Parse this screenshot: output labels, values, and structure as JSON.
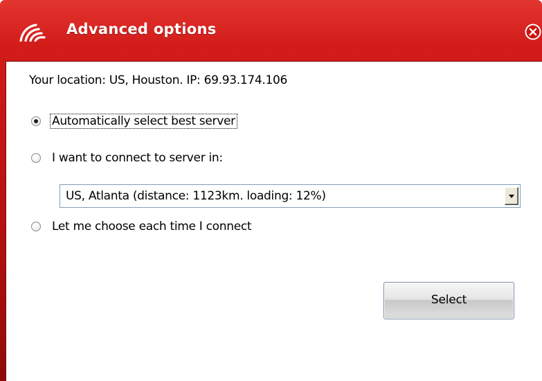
{
  "window": {
    "title": "Advanced options",
    "accent_color": "#d21c1a"
  },
  "location": {
    "text": "Your location: US, Houston.  IP: 69.93.174.106"
  },
  "options": [
    {
      "label": "Automatically select best server",
      "checked": true
    },
    {
      "label": "I want to connect to server in:",
      "checked": false
    },
    {
      "label": "Let me choose each time I connect",
      "checked": false
    }
  ],
  "server_select": {
    "selected": "US, Atlanta (distance: 1123km. loading: 12%)"
  },
  "actions": {
    "select_label": "Select"
  },
  "icons": {
    "logo": "signal-waves-logo-icon",
    "close": "close-circle-icon",
    "dropdown": "triangle-down-icon"
  }
}
